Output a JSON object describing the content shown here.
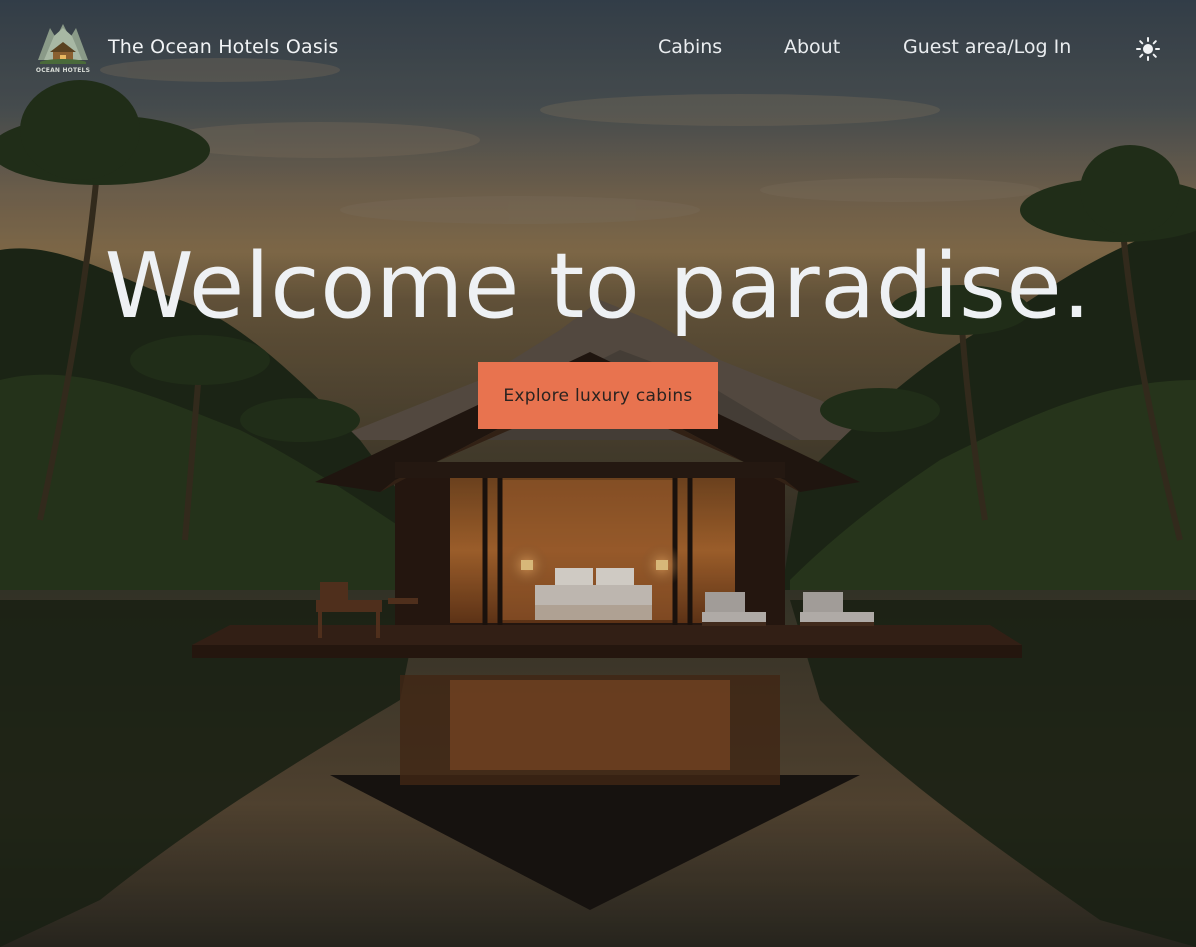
{
  "header": {
    "logo_text": "OCEAN HOTELS",
    "brand_name": "The Ocean Hotels Oasis",
    "nav": {
      "cabins": "Cabins",
      "about": "About",
      "guest": "Guest area/Log In"
    },
    "theme_toggle_icon": "sun-icon"
  },
  "hero": {
    "title": "Welcome to paradise.",
    "cta_label": "Explore luxury cabins"
  },
  "colors": {
    "accent": "#e8734f",
    "text_light": "#eef1f4"
  }
}
